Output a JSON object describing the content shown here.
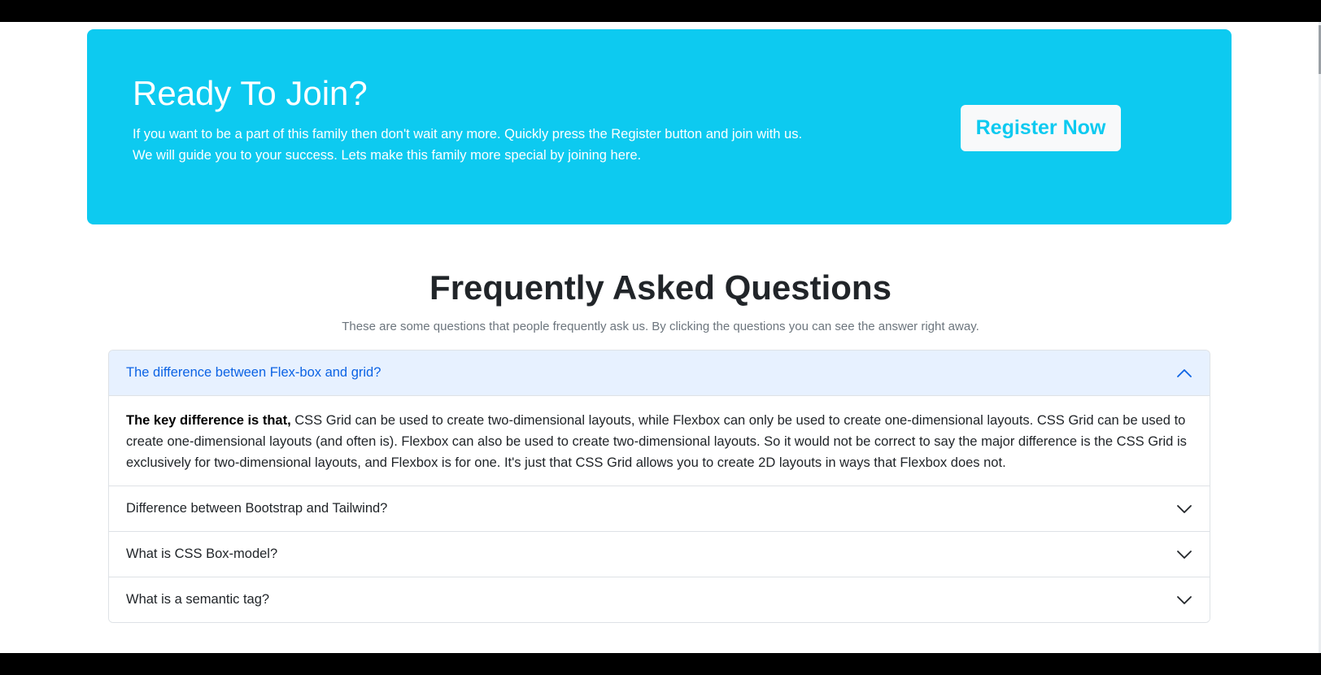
{
  "cta": {
    "title": "Ready To Join?",
    "text": "If you want to be a part of this family then don't wait any more. Quickly press the Register button and join with us. We will guide you to your success. Lets make this family more special by joining here.",
    "button_label": "Register Now",
    "bg_color": "#0dcaf0"
  },
  "faq": {
    "title": "Frequently Asked Questions",
    "subtitle": "These are some questions that people frequently ask us. By clicking the questions you can see the answer right away.",
    "items": [
      {
        "question": "The difference between Flex-box and grid?",
        "expanded": true,
        "answer_lead": "The key difference is that,",
        "answer": " CSS Grid can be used to create two-dimensional layouts, while Flexbox can only be used to create one-dimensional layouts. CSS Grid can be used to create one-dimensional layouts (and often is). Flexbox can also be used to create two-dimensional layouts. So it would not be correct to say the major difference is the CSS Grid is exclusively for two-dimensional layouts, and Flexbox is for one. It's just that CSS Grid allows you to create 2D layouts in ways that Flexbox does not.",
        "icon": "chevron-up-icon"
      },
      {
        "question": "Difference between Bootstrap and Tailwind?",
        "expanded": false,
        "icon": "chevron-down-icon"
      },
      {
        "question": "What is CSS Box-model?",
        "expanded": false,
        "icon": "chevron-down-icon"
      },
      {
        "question": "What is a semantic tag?",
        "expanded": false,
        "icon": "chevron-down-icon"
      }
    ],
    "active_color": "#0c63e4",
    "active_bg": "#e7f1ff"
  }
}
